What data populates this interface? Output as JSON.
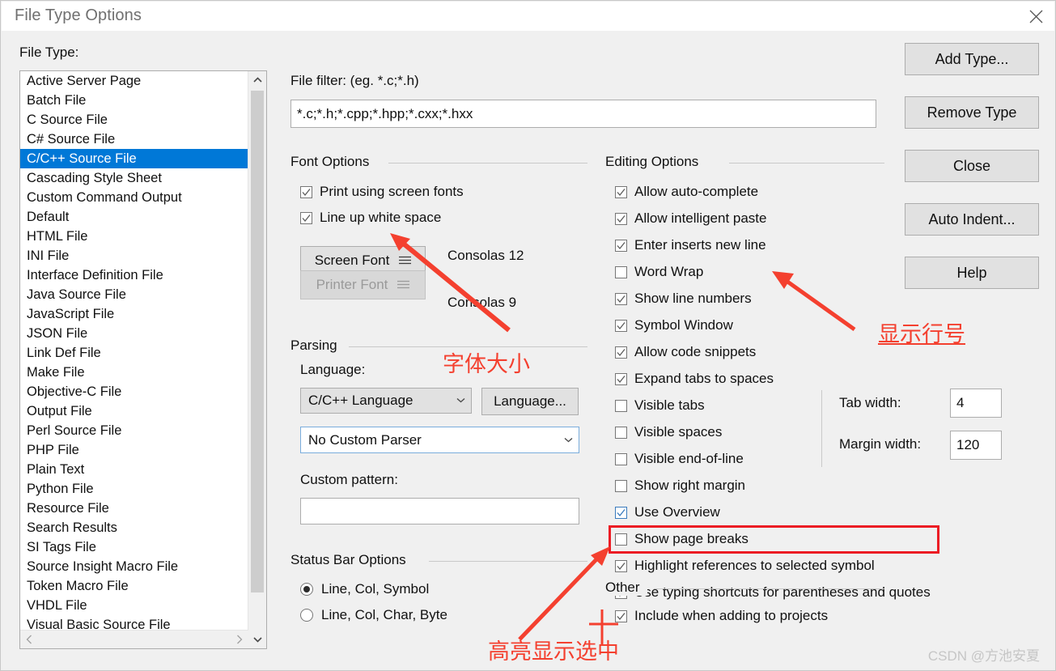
{
  "window": {
    "title": "File Type Options",
    "close_icon": "close-icon"
  },
  "left_panel": {
    "label": "File Type:",
    "selected": "C/C++ Source File",
    "items": [
      "Active Server Page",
      "Batch File",
      "C Source File",
      "C# Source File",
      "C/C++ Source File",
      "Cascading Style Sheet",
      "Custom Command Output",
      "Default",
      "HTML File",
      "INI File",
      "Interface Definition File",
      "Java Source File",
      "JavaScript File",
      "JSON File",
      "Link Def File",
      "Make File",
      "Objective-C File",
      "Output File",
      "Perl Source File",
      "PHP File",
      "Plain Text",
      "Python File",
      "Resource File",
      "Search Results",
      "SI Tags File",
      "Source Insight Macro File",
      "Token Macro File",
      "VHDL File",
      "Visual Basic Source File"
    ],
    "scroll_up_icon": "chevron-up-icon",
    "scroll_down_icon": "chevron-down-icon",
    "scroll_left_icon": "chevron-left-icon",
    "scroll_right_icon": "chevron-right-icon"
  },
  "file_filter": {
    "label": "File filter: (eg. *.c;*.h)",
    "value": "*.c;*.h;*.cpp;*.hpp;*.cxx;*.hxx"
  },
  "font_options": {
    "title": "Font Options",
    "print_using_screen_fonts": {
      "label": "Print using screen fonts",
      "checked": true
    },
    "line_up_white_space": {
      "label": "Line up white space",
      "checked": true
    },
    "screen_font_button": "Screen Font",
    "screen_font_value": "Consolas 12",
    "printer_font_button": "Printer Font",
    "printer_font_value": "Consolas 9",
    "menu_icon": "hamburger-icon"
  },
  "parsing": {
    "title": "Parsing",
    "language_label": "Language:",
    "language_value": "C/C++ Language",
    "language_button": "Language...",
    "custom_parser_value": "No Custom Parser",
    "custom_pattern_label": "Custom pattern:",
    "custom_pattern_value": ""
  },
  "status_bar_options": {
    "title": "Status Bar Options",
    "options": [
      {
        "label": "Line, Col, Symbol",
        "selected": true
      },
      {
        "label": "Line, Col, Char, Byte",
        "selected": false
      }
    ]
  },
  "editing_options": {
    "title": "Editing Options",
    "items": [
      {
        "label": "Allow auto-complete",
        "checked": true
      },
      {
        "label": "Allow intelligent paste",
        "checked": true
      },
      {
        "label": "Enter inserts new line",
        "checked": true
      },
      {
        "label": "Word Wrap",
        "checked": false
      },
      {
        "label": "Show line numbers",
        "checked": true
      },
      {
        "label": "Symbol Window",
        "checked": true
      },
      {
        "label": "Allow code snippets",
        "checked": true
      },
      {
        "label": "Expand tabs to spaces",
        "checked": true
      },
      {
        "label": "Visible tabs",
        "checked": false
      },
      {
        "label": "Visible spaces",
        "checked": false
      },
      {
        "label": "Visible end-of-line",
        "checked": false
      },
      {
        "label": "Show right margin",
        "checked": false
      },
      {
        "label": "Use Overview",
        "checked": true,
        "focused": true
      },
      {
        "label": "Show page breaks",
        "checked": false
      },
      {
        "label": "Highlight references to selected symbol",
        "checked": true,
        "highlighted": true
      },
      {
        "label": "Use typing shortcuts for parentheses and quotes",
        "checked": true
      }
    ],
    "tab_width_label": "Tab width:",
    "tab_width_value": "4",
    "margin_width_label": "Margin width:",
    "margin_width_value": "120"
  },
  "other": {
    "title": "Other",
    "include_when_adding": {
      "label": "Include when adding to projects",
      "checked": true
    }
  },
  "buttons": {
    "add_type": "Add Type...",
    "remove_type": "Remove Type",
    "close": "Close",
    "auto_indent": "Auto Indent...",
    "help": "Help"
  },
  "annotations": {
    "font_size": "字体大小",
    "show_line_numbers": "显示行号",
    "highlight_selected": "高亮显示选中",
    "color": "#f4402f"
  },
  "watermark": "CSDN @方池安夏"
}
